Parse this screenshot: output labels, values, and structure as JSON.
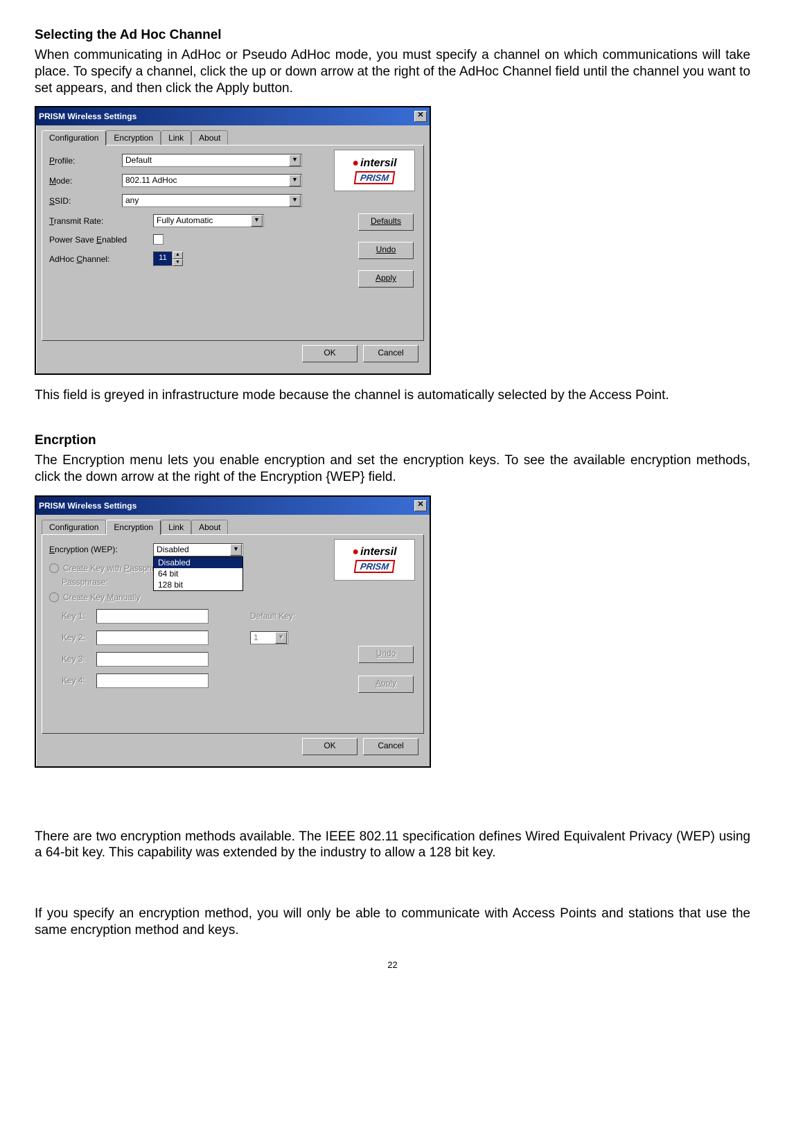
{
  "headings": {
    "adhoc": "Selecting the Ad Hoc Channel",
    "enc": "Encrption"
  },
  "paras": {
    "p1": "When communicating in AdHoc or Pseudo AdHoc mode, you must specify a channel on which communications will take place.  To specify a channel, click the up or down arrow at the right of the AdHoc Channel field until the channel you want to set appears, and then click the Apply button.",
    "p2": "This field is greyed in infrastructure mode because the channel is automatically selected by the Access Point.",
    "p3": "The Encryption menu lets you enable encryption and set the encryption keys.  To see the available encryption methods, click the down arrow at the right of the Encryption {WEP} field.",
    "p4": "There are two encryption methods available.  The IEEE 802.11 specification defines Wired Equivalent Privacy (WEP) using a 64-bit key.  This capability was extended by the industry to allow a 128 bit key.",
    "p5": "If you specify an encryption method, you will only be able to communicate with Access Points and stations that use the same encryption method and keys."
  },
  "dialog": {
    "title": "PRISM Wireless Settings",
    "tabs": {
      "config": "Configuration",
      "enc": "Encryption",
      "link": "Link",
      "about": "About"
    },
    "labels": {
      "profile": "Profile:",
      "mode": "Mode:",
      "ssid": "SSID:",
      "txrate": "Transmit Rate:",
      "pse": "Power Save Enabled",
      "adhoc": "AdHoc Channel:",
      "encwep": "Encryption (WEP):",
      "ckp": "Create Key with Passphrase",
      "pass": "Passphrase:",
      "ckm": "Create Key Manually",
      "k1": "Key 1:",
      "k2": "Key 2:",
      "k3": "Key 3:",
      "k4": "Key 4:",
      "defkey": "Default Key:"
    },
    "values": {
      "profile": "Default",
      "mode": "802.11 AdHoc",
      "ssid": "any",
      "txrate": "Fully Automatic",
      "adhoc": "11",
      "encsel": "Disabled",
      "defkey": "1"
    },
    "options": {
      "enc": [
        "Disabled",
        "64 bit",
        "128 bit"
      ]
    },
    "buttons": {
      "defaults": "Defaults",
      "undo": "Undo",
      "apply": "Apply",
      "ok": "OK",
      "cancel": "Cancel"
    },
    "logo": {
      "top": "intersil",
      "bot": "PRISM"
    }
  },
  "pagenum": "22"
}
